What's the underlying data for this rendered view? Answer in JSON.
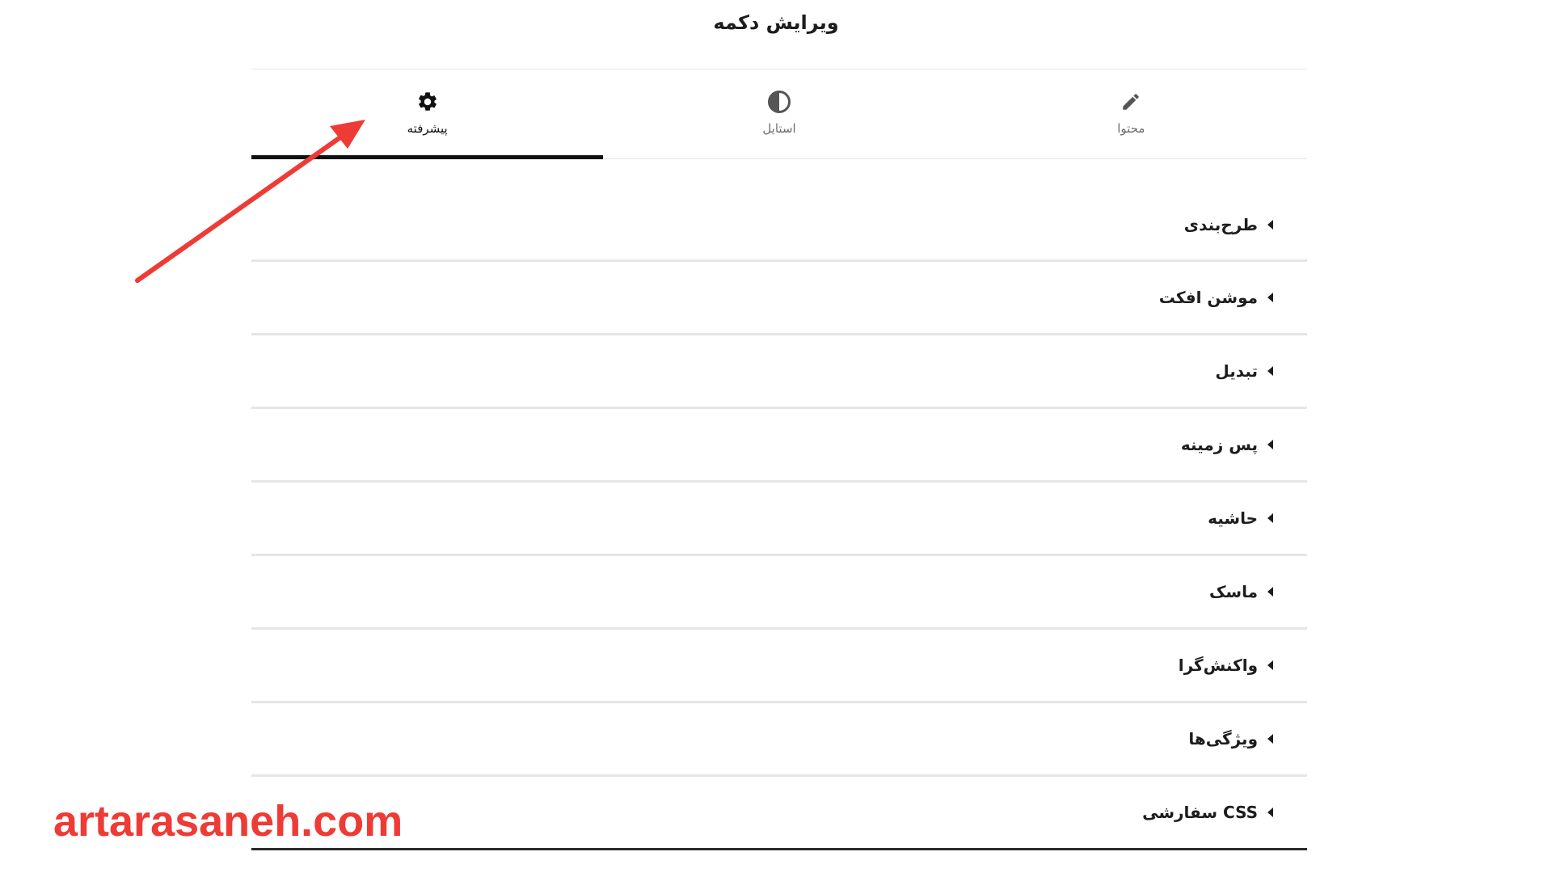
{
  "header": {
    "title": "ویرایش دکمه"
  },
  "tabs": [
    {
      "label": "محتوا",
      "icon": "pencil-icon"
    },
    {
      "label": "استایل",
      "icon": "contrast-icon"
    },
    {
      "label": "پیشرفته",
      "icon": "gear-icon",
      "active": true
    }
  ],
  "sections": [
    {
      "label": "طرح‌بندی"
    },
    {
      "label": "موشن افکت"
    },
    {
      "label": "تبدیل"
    },
    {
      "label": "پس زمینه"
    },
    {
      "label": "حاشیه"
    },
    {
      "label": "ماسک"
    },
    {
      "label": "واکنش‌گرا"
    },
    {
      "label": "ویژگی‌ها"
    },
    {
      "label": "CSS سفارشی"
    }
  ],
  "watermark": {
    "text": "artarasaneh.com",
    "color": "#ee3b36"
  },
  "annotation": {
    "arrow_color": "#ee3b36"
  }
}
